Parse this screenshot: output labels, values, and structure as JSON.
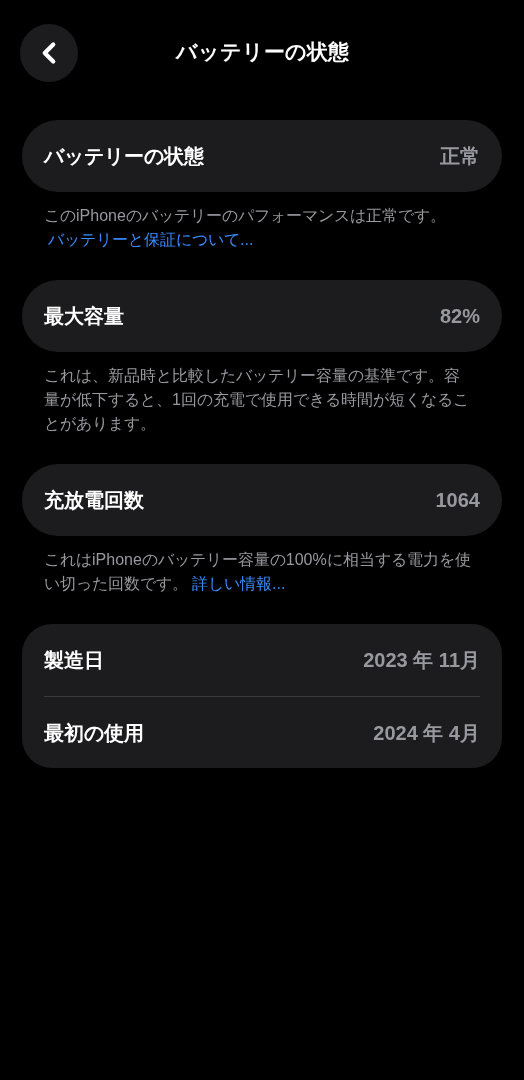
{
  "title": "バッテリーの状態",
  "sections": [
    {
      "rows": [
        {
          "label": "バッテリーの状態",
          "value": "正常"
        }
      ],
      "footer": {
        "text": "このiPhoneのバッテリーのパフォーマンスは正常です。",
        "link": "バッテリーと保証について..."
      }
    },
    {
      "rows": [
        {
          "label": "最大容量",
          "value": "82%"
        }
      ],
      "footer": {
        "text": "これは、新品時と比較したバッテリー容量の基準です。容量が低下すると、1回の充電で使用できる時間が短くなることがあります。"
      }
    },
    {
      "rows": [
        {
          "label": "充放電回数",
          "value": "1064"
        }
      ],
      "footer": {
        "text": "これはiPhoneのバッテリー容量の100%に相当する電力を使い切った回数です。",
        "link": "詳しい情報..."
      }
    },
    {
      "rows": [
        {
          "label": "製造日",
          "value": "2023 年 11月"
        },
        {
          "label": "最初の使用",
          "value": "2024 年 4月"
        }
      ]
    }
  ]
}
